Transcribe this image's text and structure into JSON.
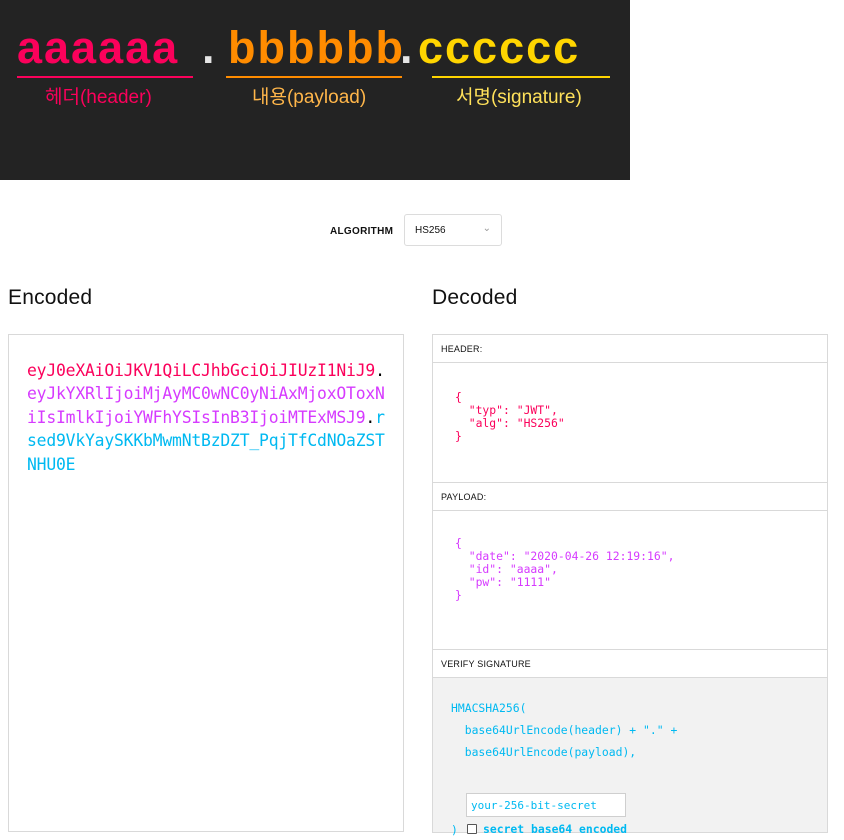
{
  "banner": {
    "header_part": "aaaaaa",
    "payload_part": "bbbbbb",
    "signature_part": "cccccc",
    "separator": ".",
    "header_label": "헤더(header)",
    "payload_label": "내용(payload)",
    "signature_label": "서명(signature)",
    "colors": {
      "header": "#fb015b",
      "payload": "#ff8c00",
      "signature": "#ffd500",
      "background": "#232323"
    }
  },
  "algorithm": {
    "label": "ALGORITHM",
    "selected": "HS256"
  },
  "encoded": {
    "title": "Encoded",
    "header_segment": "eyJ0eXAiOiJKV1QiLCJhbGciOiJIUzI1NiJ9",
    "payload_segment": "eyJkYXRlIjoiMjAyMC0wNC0yNiAxMjoxOToxNiIsImlkIjoiYWFhYSIsInB3IjoiMTExMSJ9",
    "signature_segment": "rsed9VkYaySKKbMwmNtBzDZT_PqjTfCdNOaZSTNHU0E",
    "dot": "."
  },
  "decoded": {
    "title": "Decoded",
    "header": {
      "label": "HEADER:",
      "lines": [
        "{",
        "  \"typ\": \"JWT\",",
        "  \"alg\": \"HS256\"",
        "}"
      ]
    },
    "payload": {
      "label": "PAYLOAD:",
      "lines": [
        "{",
        "  \"date\": \"2020-04-26 12:19:16\",",
        "  \"id\": \"aaaa\",",
        "  \"pw\": \"1111\"",
        "}"
      ]
    },
    "signature": {
      "label": "VERIFY SIGNATURE",
      "line1": "HMACSHA256(",
      "line2": "  base64UrlEncode(header) + \".\" +",
      "line3": "  base64UrlEncode(payload),",
      "secret_placeholder": "your-256-bit-secret",
      "close": ")",
      "checkbox_label": "secret base64 encoded"
    }
  }
}
